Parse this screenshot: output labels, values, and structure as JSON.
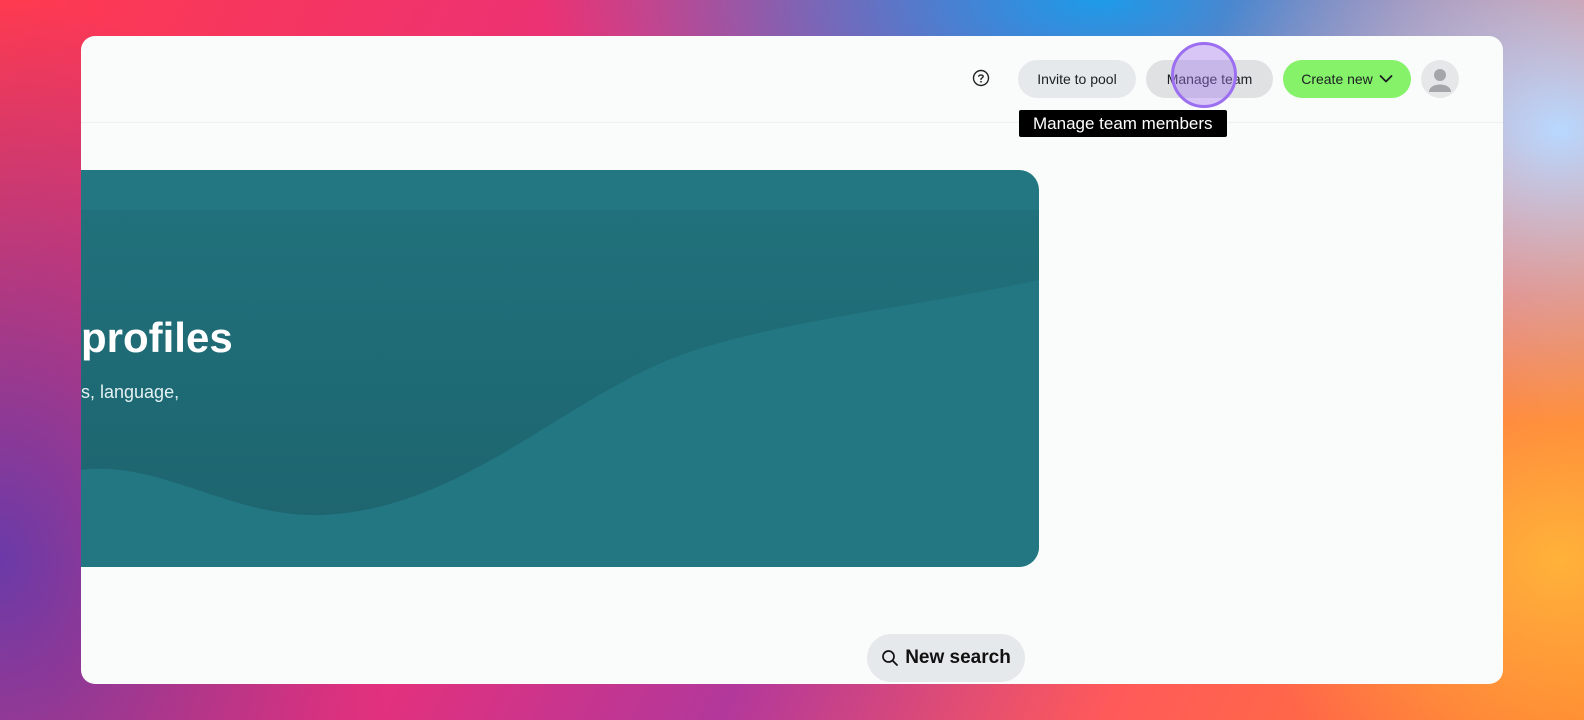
{
  "header": {
    "help_icon": "question-circle-icon",
    "invite_label": "Invite to pool",
    "manage_label": "Manage team",
    "create_label": "Create new",
    "create_icon": "chevron-down-icon",
    "avatar_icon": "user-avatar-icon"
  },
  "tooltip": {
    "text": "Manage team members"
  },
  "hero": {
    "title": "profiles",
    "subtitle": "s, language,"
  },
  "search": {
    "label": "New search",
    "icon": "search-icon"
  },
  "widget": {
    "icon": "zoho-z-icon"
  },
  "colors": {
    "hero_bg": "#227783",
    "create_bg": "#85f26a",
    "widget_bg": "#e4221d",
    "cursor_ring": "#9b6ff0"
  }
}
